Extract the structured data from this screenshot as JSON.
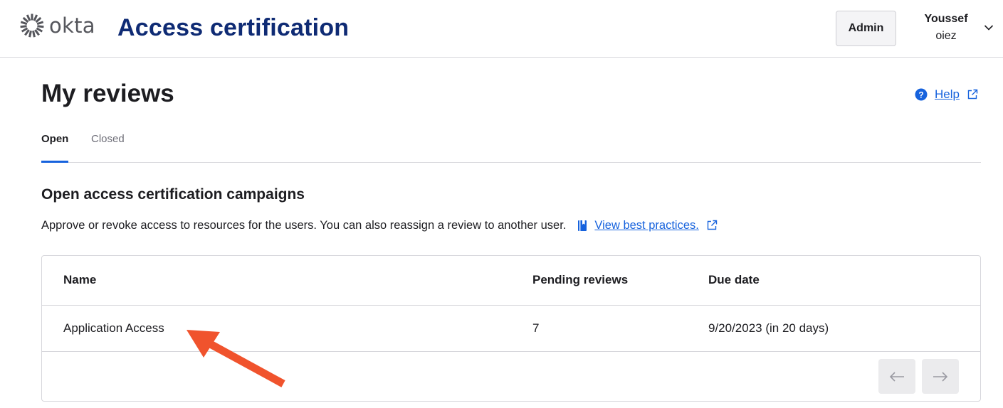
{
  "header": {
    "logo_text": "okta",
    "app_title": "Access certification",
    "admin_label": "Admin",
    "user": {
      "first_name": "Youssef",
      "last_name": "oiez"
    }
  },
  "page": {
    "title": "My reviews",
    "help_label": "Help"
  },
  "tabs": [
    {
      "label": "Open",
      "active": true
    },
    {
      "label": "Closed",
      "active": false
    }
  ],
  "section": {
    "title": "Open access certification campaigns",
    "description": "Approve or revoke access to resources for the users. You can also reassign a review to another user.",
    "best_practices_label": "View best practices."
  },
  "table": {
    "columns": [
      "Name",
      "Pending reviews",
      "Due date"
    ],
    "rows": [
      {
        "name": "Application Access",
        "pending": "7",
        "due": "9/20/2023 (in 20 days)"
      }
    ]
  },
  "colors": {
    "brand_navy": "#0f2b74",
    "link_blue": "#1662dd",
    "annotation_arrow": "#f0532d"
  }
}
